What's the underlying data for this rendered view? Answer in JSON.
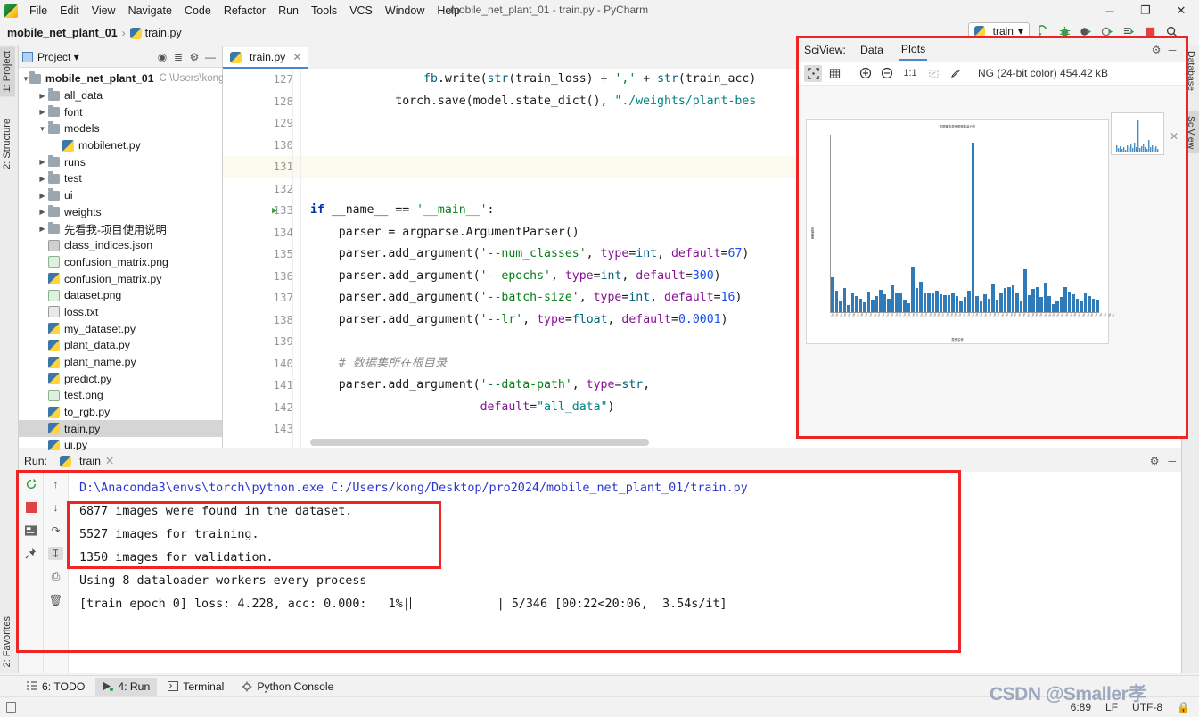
{
  "menu": {
    "items": [
      "File",
      "Edit",
      "View",
      "Navigate",
      "Code",
      "Refactor",
      "Run",
      "Tools",
      "VCS",
      "Window",
      "Help"
    ],
    "window_title": "mobile_net_plant_01 - train.py - PyCharm",
    "minimize": "─",
    "maximize": "❐",
    "close": "✕"
  },
  "breadcrumb": {
    "project": "mobile_net_plant_01",
    "separator": "›",
    "file": "train.py"
  },
  "run_toolbar": {
    "config_name": "train",
    "dropdown_caret": "▾",
    "buttons": [
      "run-icon",
      "debug-icon",
      "run-coverage-icon",
      "profile-icon",
      "run-with-console-icon",
      "stop-icon",
      "search-icon"
    ]
  },
  "left_strip": {
    "tabs": [
      "1: Project",
      "2: Structure",
      "2: Favorites"
    ],
    "active": "1: Project"
  },
  "right_strip": {
    "tabs": [
      "Database",
      "SciView"
    ],
    "active": "SciView"
  },
  "project_panel": {
    "title": "Project",
    "caret": "▾",
    "icons": [
      "locate-icon",
      "collapse-all-icon",
      "gear-icon",
      "hide-icon"
    ],
    "tree": [
      {
        "indent": 0,
        "arrow": "▼",
        "icon": "folder",
        "label": "mobile_net_plant_01",
        "bold": true,
        "path": "C:\\Users\\kong"
      },
      {
        "indent": 1,
        "arrow": "▶",
        "icon": "folder",
        "label": "all_data"
      },
      {
        "indent": 1,
        "arrow": "▶",
        "icon": "folder",
        "label": "font"
      },
      {
        "indent": 1,
        "arrow": "▼",
        "icon": "folder",
        "label": "models"
      },
      {
        "indent": 2,
        "arrow": "",
        "icon": "py",
        "label": "mobilenet.py"
      },
      {
        "indent": 1,
        "arrow": "▶",
        "icon": "folder",
        "label": "runs"
      },
      {
        "indent": 1,
        "arrow": "▶",
        "icon": "folder",
        "label": "test"
      },
      {
        "indent": 1,
        "arrow": "▶",
        "icon": "folder",
        "label": "ui"
      },
      {
        "indent": 1,
        "arrow": "▶",
        "icon": "folder",
        "label": "weights"
      },
      {
        "indent": 1,
        "arrow": "▶",
        "icon": "folder",
        "label": "先看我-项目使用说明"
      },
      {
        "indent": 1,
        "arrow": "",
        "icon": "json",
        "label": "class_indices.json"
      },
      {
        "indent": 1,
        "arrow": "",
        "icon": "png",
        "label": "confusion_matrix.png"
      },
      {
        "indent": 1,
        "arrow": "",
        "icon": "py",
        "label": "confusion_matrix.py"
      },
      {
        "indent": 1,
        "arrow": "",
        "icon": "png",
        "label": "dataset.png"
      },
      {
        "indent": 1,
        "arrow": "",
        "icon": "txt",
        "label": "loss.txt"
      },
      {
        "indent": 1,
        "arrow": "",
        "icon": "py",
        "label": "my_dataset.py"
      },
      {
        "indent": 1,
        "arrow": "",
        "icon": "py",
        "label": "plant_data.py"
      },
      {
        "indent": 1,
        "arrow": "",
        "icon": "py",
        "label": "plant_name.py"
      },
      {
        "indent": 1,
        "arrow": "",
        "icon": "py",
        "label": "predict.py"
      },
      {
        "indent": 1,
        "arrow": "",
        "icon": "png",
        "label": "test.png"
      },
      {
        "indent": 1,
        "arrow": "",
        "icon": "py",
        "label": "to_rgb.py"
      },
      {
        "indent": 1,
        "arrow": "",
        "icon": "py",
        "label": "train.py",
        "selected": true
      },
      {
        "indent": 1,
        "arrow": "",
        "icon": "py",
        "label": "ui.py"
      }
    ]
  },
  "editor": {
    "tab_label": "train.py",
    "tab_close": "✕",
    "lines": [
      {
        "num": "127",
        "html": "                <span class=\"f\">fb</span>.write(<span class=\"f\">str</span>(train_loss) + <span class=\"s\">','</span> + <span class=\"f\">str</span>(train_acc)"
      },
      {
        "num": "128",
        "html": "            torch.save(model.state_dict(), <span class=\"s2\">\"./weights/plant-bes</span>",
        "fold": true
      },
      {
        "num": "129",
        "html": ""
      },
      {
        "num": "130",
        "html": ""
      },
      {
        "num": "131",
        "html": "",
        "highlight": true
      },
      {
        "num": "132",
        "html": ""
      },
      {
        "num": "133",
        "html": "<span class=\"k\">if</span> __name__ == <span class=\"s\">'__main__'</span>:",
        "gutter_mark": "▶",
        "fold": true
      },
      {
        "num": "134",
        "html": "    parser = argparse.ArgumentParser()"
      },
      {
        "num": "135",
        "html": "    parser.add_argument(<span class=\"s\">'--num_classes'</span>, <span class=\"kw\">type</span>=<span class=\"f\">int</span>, <span class=\"kw\">default</span>=<span class=\"n\">67</span>)"
      },
      {
        "num": "136",
        "html": "    parser.add_argument(<span class=\"s\">'--epochs'</span>, <span class=\"kw\">type</span>=<span class=\"f\">int</span>, <span class=\"kw\">default</span>=<span class=\"n\">300</span>)"
      },
      {
        "num": "137",
        "html": "    parser.add_argument(<span class=\"s\">'--batch-size'</span>, <span class=\"kw\">type</span>=<span class=\"f\">int</span>, <span class=\"kw\">default</span>=<span class=\"n\">16</span>)"
      },
      {
        "num": "138",
        "html": "    parser.add_argument(<span class=\"s\">'--lr'</span>, <span class=\"kw\">type</span>=<span class=\"f\">float</span>, <span class=\"kw\">default</span>=<span class=\"n\">0.0001</span>)"
      },
      {
        "num": "139",
        "html": ""
      },
      {
        "num": "140",
        "html": "    <span class=\"cm\"># 数据集所在根目录</span>"
      },
      {
        "num": "141",
        "html": "    parser.add_argument(<span class=\"s\">'--data-path'</span>, <span class=\"kw\">type</span>=<span class=\"f\">str</span>,"
      },
      {
        "num": "142",
        "html": "                        <span class=\"kw\">default</span>=<span class=\"s2\">\"all_data\"</span>)"
      },
      {
        "num": "143",
        "html": ""
      }
    ]
  },
  "sciview": {
    "label": "SciView:",
    "tabs": [
      "Data",
      "Plots"
    ],
    "active_tab": "Plots",
    "gear": "gear-icon",
    "minimize": "─",
    "toolbar": [
      "fit-icon",
      "grid-icon",
      "zoom-in-icon",
      "zoom-out-icon",
      "actual-size-icon",
      "select-icon",
      "color-picker-icon"
    ],
    "zoom_label": "1:1",
    "image_info": "ΝG (24-bit color) 454.42 kB",
    "thumb_close": "✕"
  },
  "chart_data": {
    "type": "bar",
    "title": "数据集各类别图像数量分布",
    "xlabel": "类别名称",
    "ylabel": "图像数量",
    "ylim": [
      0,
      900
    ],
    "grid": false,
    "legend": "none",
    "categories": [
      "c01",
      "c02",
      "c03",
      "c04",
      "c05",
      "c06",
      "c07",
      "c08",
      "c09",
      "c10",
      "c11",
      "c12",
      "c13",
      "c14",
      "c15",
      "c16",
      "c17",
      "c18",
      "c19",
      "c20",
      "c21",
      "c22",
      "c23",
      "c24",
      "c25",
      "c26",
      "c27",
      "c28",
      "c29",
      "c30",
      "c31",
      "c32",
      "c33",
      "c34",
      "c35",
      "c36",
      "c37",
      "c38",
      "c39",
      "c40",
      "c41",
      "c42",
      "c43",
      "c44",
      "c45",
      "c46",
      "c47",
      "c48",
      "c49",
      "c50",
      "c51",
      "c52",
      "c53",
      "c54",
      "c55",
      "c56",
      "c57",
      "c58",
      "c59",
      "c60",
      "c61",
      "c62",
      "c63",
      "c64",
      "c65",
      "c66",
      "c67"
    ],
    "values": [
      175,
      110,
      60,
      120,
      35,
      95,
      80,
      70,
      50,
      105,
      65,
      80,
      115,
      90,
      70,
      135,
      100,
      95,
      65,
      45,
      230,
      120,
      155,
      95,
      100,
      98,
      110,
      90,
      85,
      88,
      100,
      80,
      55,
      75,
      108,
      860,
      82,
      60,
      90,
      70,
      145,
      62,
      95,
      120,
      128,
      135,
      100,
      60,
      218,
      85,
      118,
      128,
      75,
      148,
      82,
      40,
      55,
      78,
      125,
      105,
      90,
      70,
      60,
      95,
      80,
      70,
      65
    ]
  },
  "run_panel": {
    "label": "Run:",
    "tab_name": "train",
    "tab_close": "✕",
    "gear": "gear-icon",
    "minimize": "─",
    "left_tools": [
      "rerun-icon",
      "stop-icon",
      "console-icon",
      "pin-icon"
    ],
    "right_tools": [
      "up-arrow-icon",
      "down-arrow-icon",
      "soft-wrap-icon",
      "scroll-to-end-icon",
      "print-icon",
      "trash-icon"
    ],
    "console_lines": [
      {
        "text": "D:\\Anaconda3\\envs\\torch\\python.exe C:/Users/kong/Desktop/pro2024/mobile_net_plant_01/train.py",
        "link": true
      },
      {
        "text": "6877 images were found in the dataset."
      },
      {
        "text": "5527 images for training."
      },
      {
        "text": "1350 images for validation."
      },
      {
        "text": "Using 8 dataloader workers every process"
      },
      {
        "text": "[train epoch 0] loss: 4.228, acc: 0.000:   1%|",
        "caret": true,
        "tail": "            | 5/346 [00:22<20:06,  3.54s/it]"
      }
    ]
  },
  "bottom_tabs": [
    {
      "label": "6: TODO",
      "icon": "todo-icon"
    },
    {
      "label": "4: Run",
      "icon": "run-icon",
      "active": true
    },
    {
      "label": "Terminal",
      "icon": "terminal-icon"
    },
    {
      "label": "Python Console",
      "icon": "python-console-icon"
    }
  ],
  "statusbar": {
    "caret_position": "6:89",
    "line_separator": "LF",
    "encoding": "UTF-8",
    "lock_icon": "lock-icon",
    "watermark": "CSDN @Smaller孝"
  },
  "colors": {
    "accent": "#4a88c7",
    "highlight_box": "#ef2525",
    "bar": "#2f7ab8",
    "link": "#2b37c9",
    "keyword": "#0033b3",
    "string": "#067d17"
  }
}
